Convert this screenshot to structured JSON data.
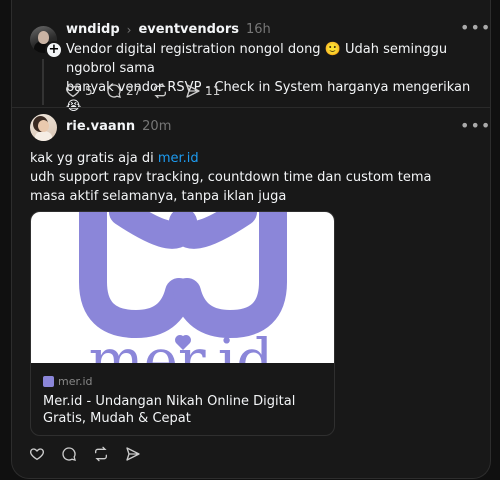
{
  "post1": {
    "username": "wndidp",
    "replying_to": "eventvendors",
    "time": "16h",
    "text_line1": "Vendor digital registration nongol dong 🙂 Udah seminggu ngobrol sama",
    "text_line2": "banyak vendor RSVP - Check in System harganya mengerikan 😭",
    "likes": "5",
    "replies": "27",
    "shares": "11"
  },
  "post2": {
    "username": "rie.vaann",
    "time": "20m",
    "text_line1_prefix": "kak yg gratis aja di ",
    "text_line1_link": "mer.id",
    "text_line2": "udh support rapv tracking, countdown time dan custom tema",
    "text_line3": "masa aktif selamanya, tanpa iklan juga"
  },
  "link_card": {
    "site": "mer.id",
    "title": "Mer.id - Undangan Nikah Online Digital Gratis, Mudah & Cepat",
    "logo_text": "mer.id",
    "accent": "#8b86d9"
  },
  "icons": {
    "more": "more-dots-icon",
    "like": "heart-icon",
    "reply": "comment-icon",
    "repost": "repost-icon",
    "share": "send-icon"
  }
}
